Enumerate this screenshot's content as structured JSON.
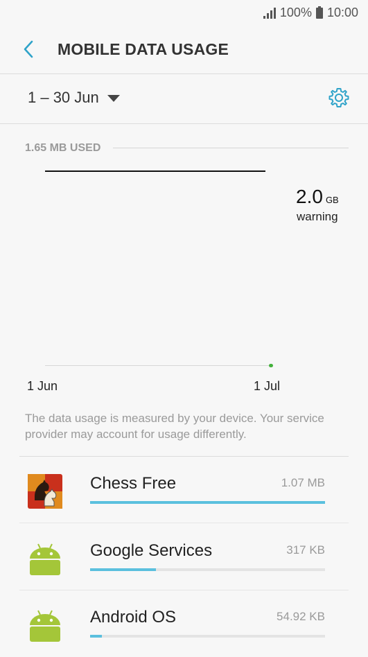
{
  "status_bar": {
    "battery": "100%",
    "time": "10:00"
  },
  "header": {
    "title": "MOBILE DATA USAGE",
    "back_icon": "chevron-left-icon"
  },
  "period": {
    "label": "1 – 30 Jun",
    "settings_icon": "gear-icon"
  },
  "usage": {
    "used_label": "1.65 MB USED"
  },
  "chart": {
    "warning_value": "2.0",
    "warning_unit": "GB",
    "warning_label": "warning",
    "x_start": "1 Jun",
    "x_end": "1 Jul"
  },
  "note": "The data usage is measured by your device. Your service provider may account for usage differently.",
  "apps": [
    {
      "name": "Chess Free",
      "size": "1.07 MB",
      "usage_fraction": 1.0,
      "icon": "chess-icon"
    },
    {
      "name": "Google Services",
      "size": "317 KB",
      "usage_fraction": 0.28,
      "icon": "android-icon"
    },
    {
      "name": "Android OS",
      "size": "54.92 KB",
      "usage_fraction": 0.05,
      "icon": "android-icon"
    }
  ],
  "colors": {
    "accent": "#5bc0de",
    "android_green": "#a4c639",
    "usage_dot": "#43b13b"
  }
}
